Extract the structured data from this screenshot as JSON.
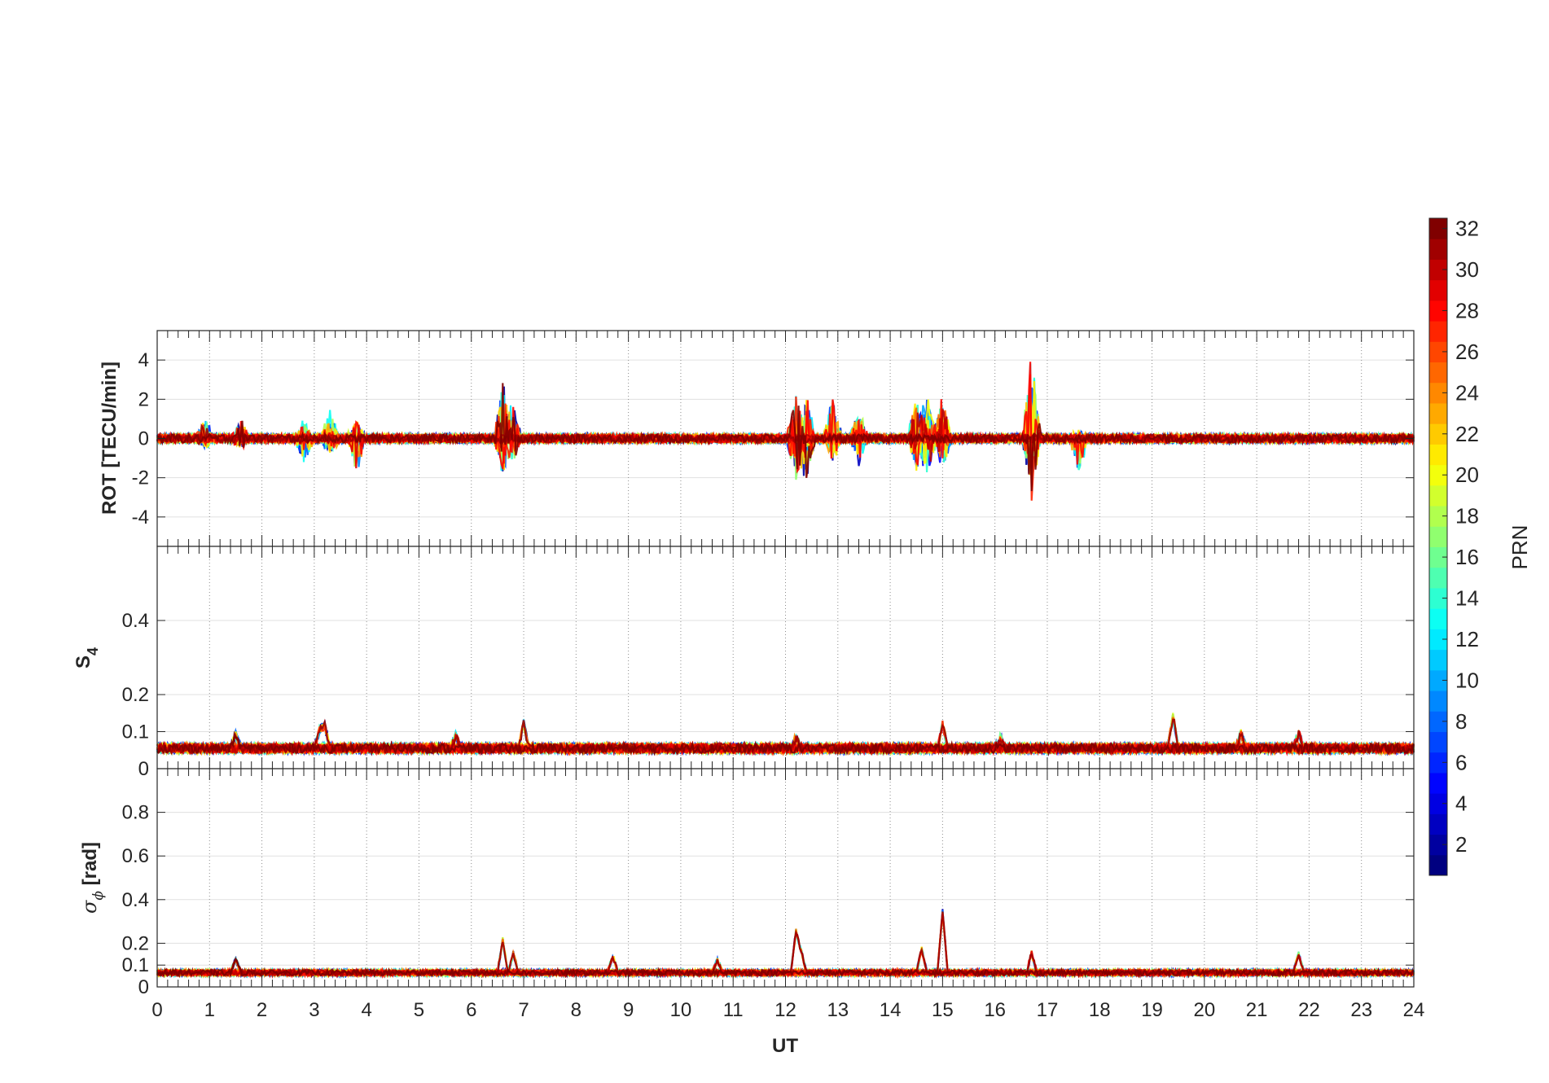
{
  "figure": {
    "xlabel": "UT",
    "colorbar": {
      "label": "PRN",
      "ticks": [
        "2",
        "4",
        "6",
        "8",
        "10",
        "12",
        "14",
        "16",
        "18",
        "20",
        "22",
        "24",
        "26",
        "28",
        "30",
        "32"
      ],
      "range": [
        1,
        32
      ],
      "colormap": "jet"
    }
  },
  "chart_data": [
    {
      "type": "line",
      "panel": "top",
      "ylabel": "ROT [TECU/min]",
      "xlim": [
        0,
        24
      ],
      "ylim": [
        -5.5,
        5.5
      ],
      "yticks": [
        "-4",
        "-2",
        "0",
        "2",
        "4"
      ],
      "xticks": [],
      "grid": true,
      "series_color_by": "PRN (1-32)",
      "baseline": 0,
      "noise_amplitude": 0.3,
      "bursts": [
        {
          "t": 0.9,
          "max": 0.9,
          "min": -0.5
        },
        {
          "t": 1.6,
          "max": 0.9,
          "min": -0.4
        },
        {
          "t": 2.8,
          "max": 0.9,
          "min": -1.5
        },
        {
          "t": 3.3,
          "max": 1.4,
          "min": -0.9
        },
        {
          "t": 3.8,
          "max": 1.1,
          "min": -1.8
        },
        {
          "t": 6.6,
          "max": 3.0,
          "min": -1.8
        },
        {
          "t": 6.8,
          "max": 1.6,
          "min": -1.2
        },
        {
          "t": 12.2,
          "max": 2.1,
          "min": -2.3
        },
        {
          "t": 12.4,
          "max": 2.1,
          "min": -2.0
        },
        {
          "t": 12.9,
          "max": 2.2,
          "min": -1.3
        },
        {
          "t": 13.4,
          "max": 1.6,
          "min": -1.3
        },
        {
          "t": 14.5,
          "max": 2.3,
          "min": -1.7
        },
        {
          "t": 14.7,
          "max": 2.4,
          "min": -1.9
        },
        {
          "t": 15.0,
          "max": 2.3,
          "min": -1.5
        },
        {
          "t": 16.7,
          "max": 4.6,
          "min": -3.0
        },
        {
          "t": 17.6,
          "max": 0.4,
          "min": -1.8
        }
      ]
    },
    {
      "type": "line",
      "panel": "middle",
      "ylabel": "S4",
      "xlim": [
        0,
        24
      ],
      "ylim": [
        0,
        0.6
      ],
      "yticks": [
        "0",
        "0.1",
        "0.2",
        "0.4"
      ],
      "xticks": [],
      "grid": true,
      "series_color_by": "PRN (1-32)",
      "baseline": 0.05,
      "peaks": [
        {
          "t": 1.5,
          "v": 0.085
        },
        {
          "t": 3.1,
          "v": 0.1
        },
        {
          "t": 3.2,
          "v": 0.11
        },
        {
          "t": 5.7,
          "v": 0.085
        },
        {
          "t": 7.0,
          "v": 0.115
        },
        {
          "t": 12.2,
          "v": 0.08
        },
        {
          "t": 15.0,
          "v": 0.115
        },
        {
          "t": 16.1,
          "v": 0.08
        },
        {
          "t": 19.4,
          "v": 0.14
        },
        {
          "t": 20.7,
          "v": 0.09
        },
        {
          "t": 21.8,
          "v": 0.09
        }
      ]
    },
    {
      "type": "line",
      "panel": "bottom",
      "ylabel": "σφ [rad]",
      "xlim": [
        0,
        24
      ],
      "ylim": [
        0,
        1.0
      ],
      "yticks": [
        "0",
        "0.1",
        "0.2",
        "0.4",
        "0.6",
        "0.8"
      ],
      "xticks": [
        "0",
        "1",
        "2",
        "3",
        "4",
        "5",
        "6",
        "7",
        "8",
        "9",
        "10",
        "11",
        "12",
        "13",
        "14",
        "15",
        "16",
        "17",
        "18",
        "19",
        "20",
        "21",
        "22",
        "23",
        "24"
      ],
      "grid": true,
      "series_color_by": "PRN (1-32)",
      "baseline": 0.06,
      "peaks": [
        {
          "t": 1.5,
          "v": 0.12
        },
        {
          "t": 6.6,
          "v": 0.21
        },
        {
          "t": 6.8,
          "v": 0.15
        },
        {
          "t": 8.7,
          "v": 0.14
        },
        {
          "t": 10.7,
          "v": 0.12
        },
        {
          "t": 12.2,
          "v": 0.25
        },
        {
          "t": 12.3,
          "v": 0.16
        },
        {
          "t": 14.6,
          "v": 0.17
        },
        {
          "t": 15.0,
          "v": 0.34
        },
        {
          "t": 16.7,
          "v": 0.15
        },
        {
          "t": 21.8,
          "v": 0.15
        }
      ]
    }
  ]
}
